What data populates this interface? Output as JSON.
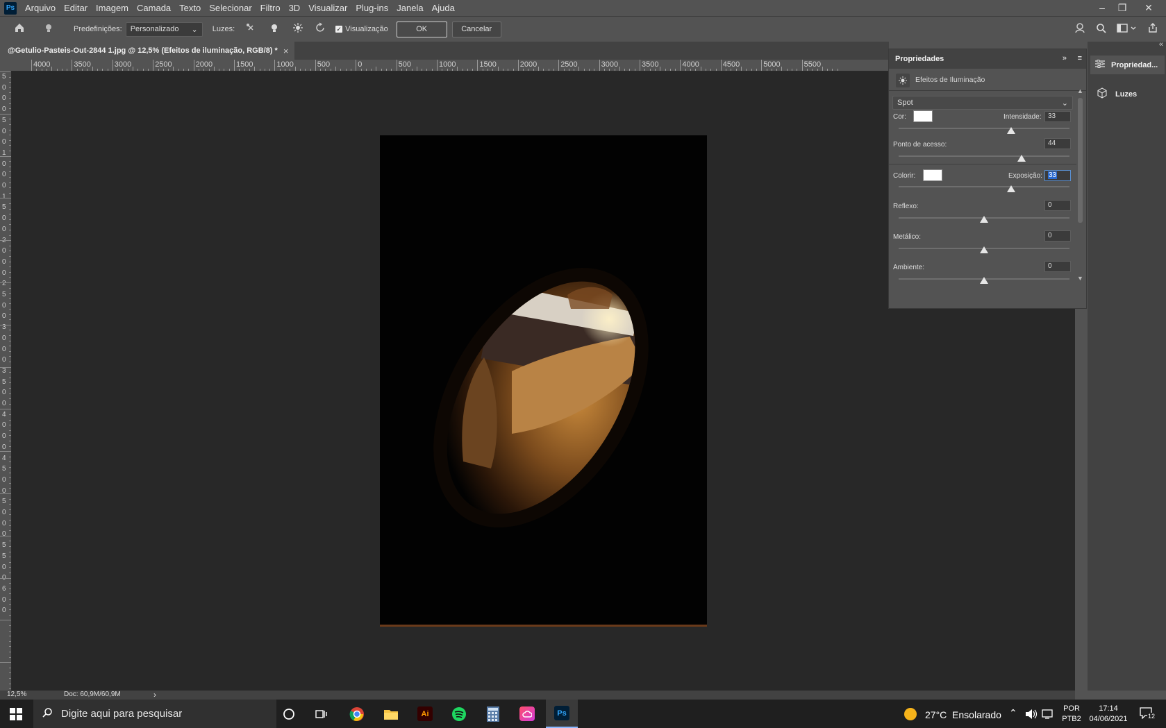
{
  "app": {
    "logo": "Ps"
  },
  "menu": [
    "Arquivo",
    "Editar",
    "Imagem",
    "Camada",
    "Texto",
    "Selecionar",
    "Filtro",
    "3D",
    "Visualizar",
    "Plug-ins",
    "Janela",
    "Ajuda"
  ],
  "window_controls": {
    "minimize": "–",
    "restore": "❐",
    "close": "✕"
  },
  "options_bar": {
    "presets_label": "Predefinições:",
    "presets_value": "Personalizado",
    "lights_label": "Luzes:",
    "preview_label": "Visualização",
    "preview_checked": true,
    "ok_label": "OK",
    "cancel_label": "Cancelar"
  },
  "document_tab": {
    "title": "@Getulio-Pasteis-Out-2844 1.jpg @ 12,5% (Efeitos de iluminação, RGB/8) *",
    "close": "×"
  },
  "ruler_h": [
    "4000",
    "3500",
    "3000",
    "2500",
    "2000",
    "1500",
    "1000",
    "500",
    "0",
    "500",
    "1000",
    "1500",
    "2000",
    "2500",
    "3000",
    "3500",
    "4000",
    "4500",
    "5000",
    "5500"
  ],
  "ruler_v": [
    "5",
    "0",
    "0",
    "0",
    "5",
    "0",
    "0",
    "1",
    "0",
    "0",
    "0",
    "1",
    "5",
    "0",
    "0",
    "2",
    "0",
    "0",
    "0",
    "2",
    "5",
    "0",
    "0",
    "3",
    "0",
    "0",
    "0",
    "3",
    "5",
    "0",
    "0",
    "4",
    "0",
    "0",
    "0",
    "4",
    "5",
    "0",
    "0",
    "5",
    "0",
    "0",
    "0",
    "5",
    "5",
    "0",
    "0",
    "6",
    "0",
    "0"
  ],
  "status": {
    "zoom": "12,5%",
    "doc": "Doc: 60,9M/60,9M",
    "arrow": "›"
  },
  "properties": {
    "title": "Propriedades",
    "effect_title": "Efeitos de Iluminação",
    "light_type": "Spot",
    "color_label": "Cor:",
    "intensity_label": "Intensidade:",
    "intensity_value": "33",
    "hotspot_label": "Ponto de acesso:",
    "hotspot_value": "44",
    "colorize_label": "Colorir:",
    "exposure_label": "Exposição:",
    "exposure_value": "33",
    "gloss_label": "Reflexo:",
    "gloss_value": "0",
    "metallic_label": "Metálico:",
    "metallic_value": "0",
    "ambient_label": "Ambiente:",
    "ambient_value": "0",
    "slider_levels": {
      "intensity": 0.66,
      "hotspot": 0.72,
      "exposure": 0.66,
      "gloss": 0.5,
      "metallic": 0.5,
      "ambient": 0.5
    }
  },
  "dock": {
    "properties_label": "Propriedad...",
    "lights_label": "Luzes"
  },
  "taskbar": {
    "search_placeholder": "Digite aqui para pesquisar",
    "weather": "27°C  Ensolarado",
    "lang_top": "POR",
    "lang_bottom": "PTB2",
    "time": "17:14",
    "date": "04/06/2021",
    "notifications": "12"
  },
  "colors": {
    "accent": "#31a8ff",
    "panel_bg": "#535353",
    "canvas_bg": "#282828"
  }
}
